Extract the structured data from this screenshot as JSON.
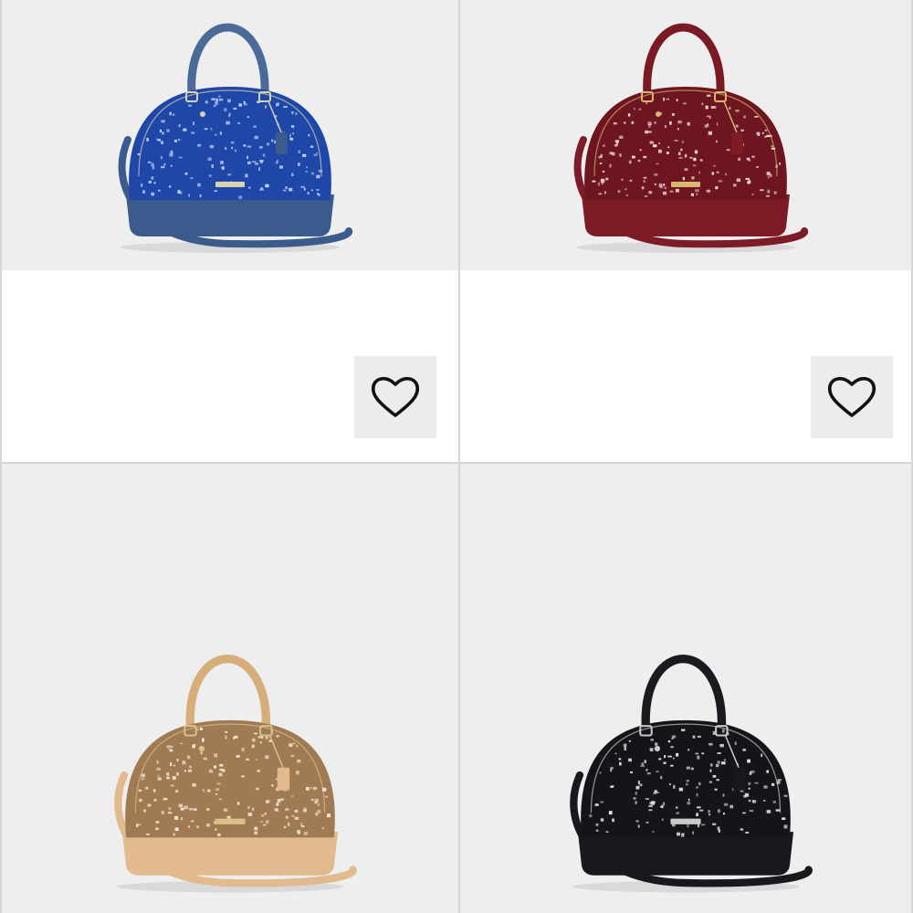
{
  "products": [
    {
      "name": "blue",
      "body": "#1f47a8",
      "trim": "#3a5b8c",
      "handle": "#4a6a98",
      "sparkle": "#c7dbff",
      "hardware": "#d8d2b0",
      "favorite_icon": "heart-outline-icon"
    },
    {
      "name": "burgundy",
      "body": "#6e1620",
      "trim": "#7d1c26",
      "handle": "#7a1a24",
      "sparkle": "#f2dfe0",
      "hardware": "#d9b770",
      "favorite_icon": "heart-outline-icon"
    },
    {
      "name": "gold",
      "body": "#a07a52",
      "trim": "#e1bb8d",
      "handle": "#d7ad7a",
      "sparkle": "#f7ecd9",
      "hardware": "#d9c08a",
      "favorite_icon": ""
    },
    {
      "name": "black",
      "body": "#141518",
      "trim": "#18191d",
      "handle": "#1a1b1f",
      "sparkle": "#e8e8ec",
      "hardware": "#c9c9c9",
      "favorite_icon": ""
    }
  ],
  "colors": {
    "image_background": "#eeeeef",
    "card_background": "#ffffff",
    "divider": "#d6d6d6",
    "favorite_button_bg": "#ececec",
    "icon_stroke": "#111111"
  }
}
